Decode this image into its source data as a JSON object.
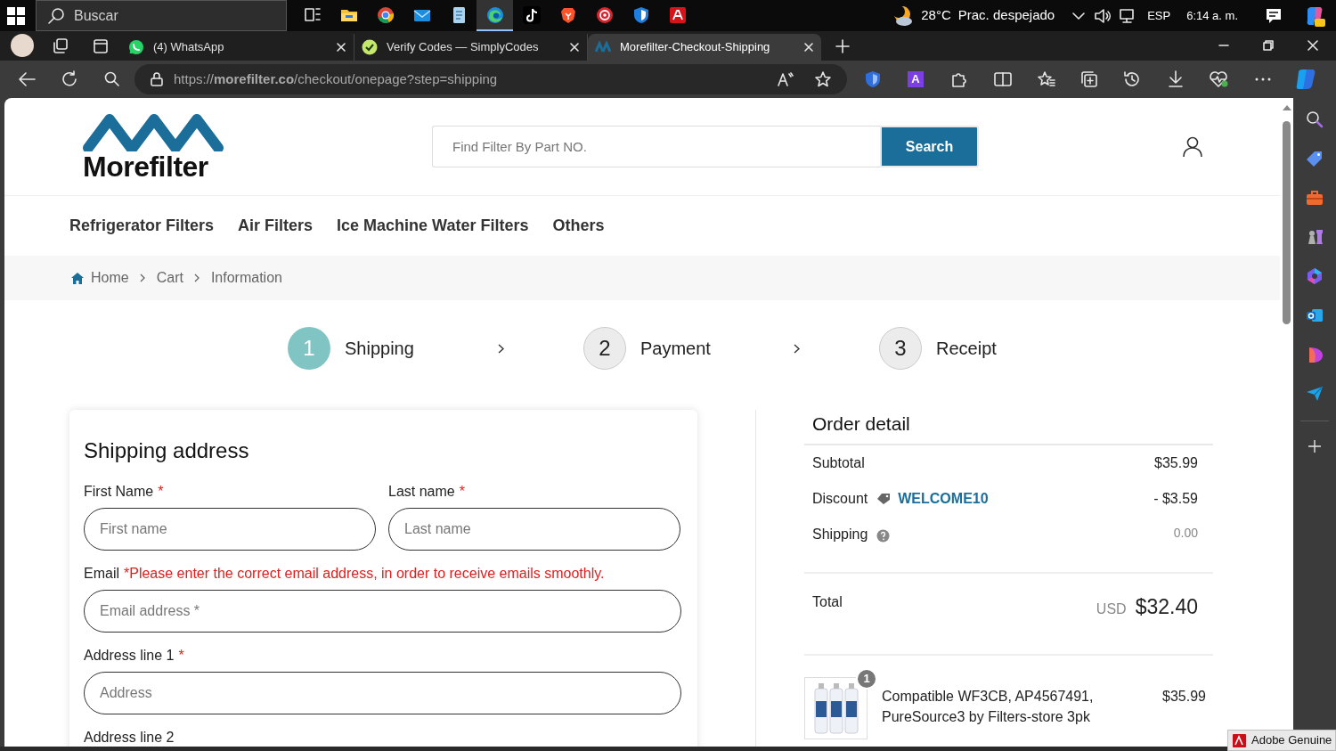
{
  "taskbar": {
    "search_placeholder": "Buscar",
    "apps": [
      {
        "kind": "taskview",
        "selected": false
      },
      {
        "kind": "explorer",
        "selected": false
      },
      {
        "kind": "chrome",
        "selected": false
      },
      {
        "kind": "mail",
        "selected": false
      },
      {
        "kind": "notepad",
        "selected": false
      },
      {
        "kind": "edge",
        "selected": true
      },
      {
        "kind": "tiktok",
        "selected": false
      },
      {
        "kind": "brave",
        "selected": false
      },
      {
        "kind": "redcircle",
        "selected": false
      },
      {
        "kind": "shield",
        "selected": false
      },
      {
        "kind": "adobe",
        "selected": false
      }
    ],
    "temperature": "28°C",
    "weather": "Prac. despejado",
    "language": "ESP",
    "time": "6:14 a. m."
  },
  "browser": {
    "tabs": [
      {
        "kind": "whatsapp",
        "title": "(4) WhatsApp",
        "selected": false
      },
      {
        "kind": "check",
        "title": "Verify Codes — SimplyCodes",
        "selected": false
      },
      {
        "kind": "morefilter",
        "title": "Morefilter-Checkout-Shipping",
        "selected": true
      }
    ],
    "url": "https://**morefilter.co**/checkout/onepage?step=shipping",
    "extension_letter": "A"
  },
  "header": {
    "logo_text": "Morefilter",
    "search_placeholder": "Find Filter By Part NO.",
    "search_button": "Search"
  },
  "nav": [
    "Refrigerator Filters",
    "Air Filters",
    "Ice Machine Water Filters",
    "Others"
  ],
  "breadcrumb": [
    "Home",
    "Cart",
    "Information"
  ],
  "steps": [
    {
      "number": "1",
      "label": "Shipping",
      "selected": true
    },
    {
      "number": "2",
      "label": "Payment",
      "selected": false
    },
    {
      "number": "3",
      "label": "Receipt",
      "selected": false
    }
  ],
  "shipping_form": {
    "title": "Shipping address",
    "fields": [
      {
        "kind": "half",
        "label": "First Name",
        "required_mark": "*",
        "placeholder": "First name"
      },
      {
        "kind": "half",
        "label": "Last name",
        "required_mark": "*",
        "placeholder": "Last name"
      },
      {
        "kind": "full",
        "label": "Email",
        "note": "*Please enter the correct email address, in order to receive emails smoothly.",
        "placeholder": "Email address *"
      },
      {
        "kind": "full",
        "label": "Address line 1",
        "required_mark": "*",
        "placeholder": "Address"
      },
      {
        "kind": "full",
        "label": "Address line 2"
      }
    ]
  },
  "order_detail": {
    "title": "Order detail",
    "rows": [
      {
        "kind": "plain",
        "label": "Subtotal",
        "value": "$35.99"
      },
      {
        "kind": "discount",
        "label": "Discount",
        "code": "WELCOME10",
        "value": "- $3.59"
      },
      {
        "kind": "help",
        "label": "Shipping",
        "value": "0.00"
      }
    ],
    "total_label": "Total",
    "currency": "USD",
    "total": "$32.40",
    "items": [
      {
        "quantity": "1",
        "name": "Compatible WF3CB, AP4567491, PureSource3 by Filters-store 3pk",
        "price": "$35.99"
      }
    ]
  },
  "notification": {
    "text": "Adobe Genuine"
  }
}
